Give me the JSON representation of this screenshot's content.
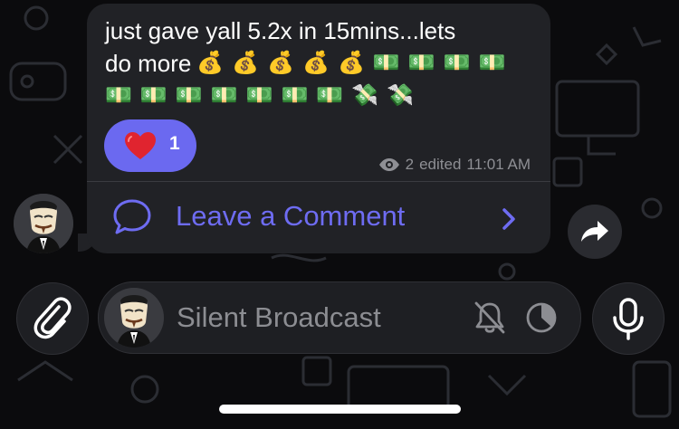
{
  "message": {
    "text": "just gave yall 5.2x in 15mins...lets",
    "text_line2": "do more",
    "emoji_line2": [
      "💰",
      "💰",
      "💰",
      "💰",
      "💰",
      "💵",
      "💵",
      "💵",
      "💵"
    ],
    "emoji_line3": [
      "💵",
      "💵",
      "💵",
      "💵",
      "💵",
      "💵",
      "💵",
      "💸",
      "💸"
    ],
    "reaction": {
      "icon": "heart-icon",
      "count": "1"
    },
    "views": "2",
    "edited_label": "edited",
    "time": "11:01 AM",
    "comment_label": "Leave a Comment"
  },
  "composer": {
    "placeholder": "Silent Broadcast"
  },
  "colors": {
    "accent": "#6b69f0",
    "bubble": "#212226",
    "background": "#0b0b0d",
    "heart": "#e0242f"
  }
}
